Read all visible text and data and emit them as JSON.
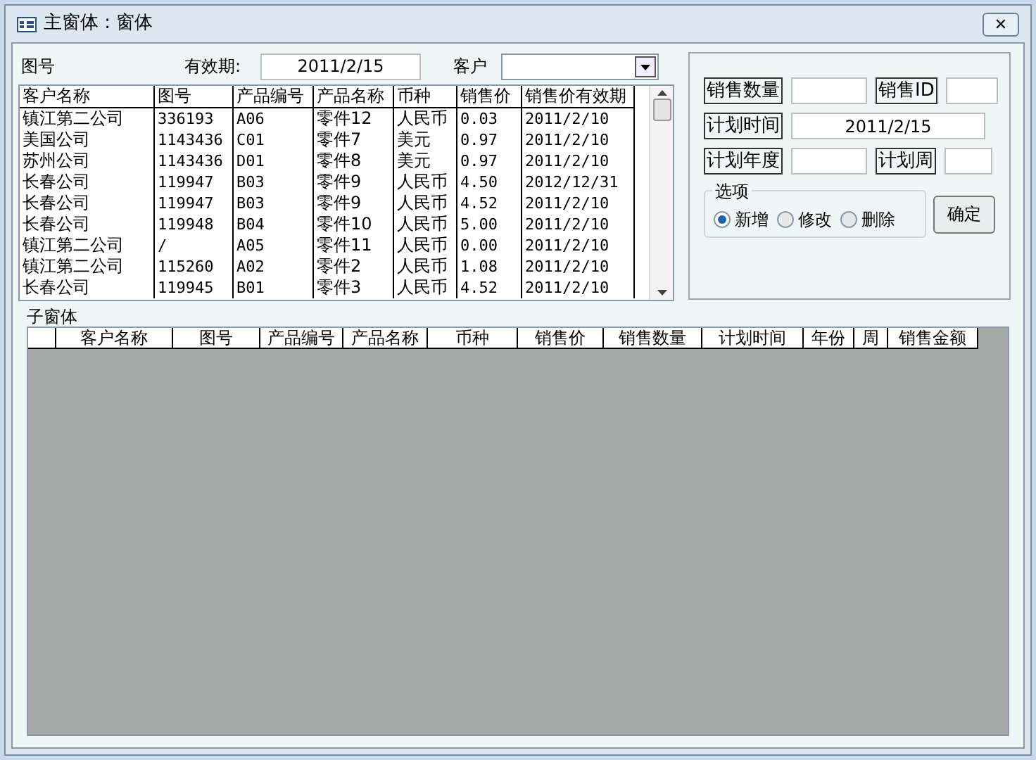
{
  "window": {
    "title": "主窗体 : 窗体",
    "close": "✕"
  },
  "filters": {
    "drawing_label": "图号",
    "validity_label": "有效期:",
    "validity_value": "2011/2/15",
    "customer_label": "客户"
  },
  "price_list": {
    "columns": [
      "客户名称",
      "图号",
      "产品编号",
      "产品名称",
      "币种",
      "销售价",
      "销售价有效期"
    ],
    "rows": [
      [
        "镇江第二公司",
        "336193",
        "A06",
        "零件12",
        "人民币",
        "0.03",
        "2011/2/10"
      ],
      [
        "美国公司",
        "1143436",
        "C01",
        "零件7",
        "美元",
        "0.97",
        "2011/2/10"
      ],
      [
        "苏州公司",
        "1143436",
        "D01",
        "零件8",
        "美元",
        "0.97",
        "2011/2/10"
      ],
      [
        "长春公司",
        "119947",
        "B03",
        "零件9",
        "人民币",
        "4.50",
        "2012/12/31"
      ],
      [
        "长春公司",
        "119947",
        "B03",
        "零件9",
        "人民币",
        "4.52",
        "2011/2/10"
      ],
      [
        "长春公司",
        "119948",
        "B04",
        "零件10",
        "人民币",
        "5.00",
        "2011/2/10"
      ],
      [
        "镇江第二公司",
        "/",
        "A05",
        "零件11",
        "人民币",
        "0.00",
        "2011/2/10"
      ],
      [
        "镇江第二公司",
        "115260",
        "A02",
        "零件2",
        "人民币",
        "1.08",
        "2011/2/10"
      ],
      [
        "长春公司",
        "119945",
        "B01",
        "零件3",
        "人民币",
        "4.52",
        "2011/2/10"
      ]
    ]
  },
  "entry": {
    "quantity_label": "销售数量",
    "id_label": "销售ID",
    "plan_time_label": "计划时间",
    "plan_time_value": "2011/2/15",
    "plan_year_label": "计划年度",
    "plan_week_label": "计划周",
    "options_title": "选项",
    "options": [
      {
        "label": "新增",
        "selected": true
      },
      {
        "label": "修改",
        "selected": false
      },
      {
        "label": "删除",
        "selected": false
      }
    ],
    "confirm": "确定"
  },
  "subform": {
    "label": "子窗体",
    "columns": [
      "",
      "客户名称",
      "图号",
      "产品编号",
      "产品名称",
      "币种",
      "销售价",
      "销售数量",
      "计划时间",
      "年份",
      "周",
      "销售金额"
    ]
  }
}
